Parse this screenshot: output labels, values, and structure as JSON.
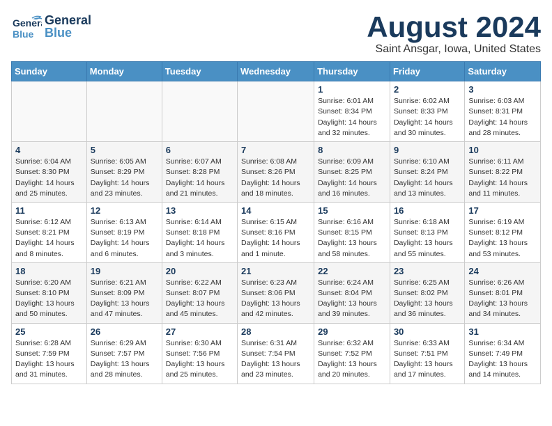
{
  "header": {
    "logo_general": "General",
    "logo_blue": "Blue",
    "main_title": "August 2024",
    "subtitle": "Saint Ansgar, Iowa, United States"
  },
  "days_of_week": [
    "Sunday",
    "Monday",
    "Tuesday",
    "Wednesday",
    "Thursday",
    "Friday",
    "Saturday"
  ],
  "weeks": [
    [
      {
        "day": "",
        "info": ""
      },
      {
        "day": "",
        "info": ""
      },
      {
        "day": "",
        "info": ""
      },
      {
        "day": "",
        "info": ""
      },
      {
        "day": "1",
        "info": "Sunrise: 6:01 AM\nSunset: 8:34 PM\nDaylight: 14 hours and 32 minutes."
      },
      {
        "day": "2",
        "info": "Sunrise: 6:02 AM\nSunset: 8:33 PM\nDaylight: 14 hours and 30 minutes."
      },
      {
        "day": "3",
        "info": "Sunrise: 6:03 AM\nSunset: 8:31 PM\nDaylight: 14 hours and 28 minutes."
      }
    ],
    [
      {
        "day": "4",
        "info": "Sunrise: 6:04 AM\nSunset: 8:30 PM\nDaylight: 14 hours and 25 minutes."
      },
      {
        "day": "5",
        "info": "Sunrise: 6:05 AM\nSunset: 8:29 PM\nDaylight: 14 hours and 23 minutes."
      },
      {
        "day": "6",
        "info": "Sunrise: 6:07 AM\nSunset: 8:28 PM\nDaylight: 14 hours and 21 minutes."
      },
      {
        "day": "7",
        "info": "Sunrise: 6:08 AM\nSunset: 8:26 PM\nDaylight: 14 hours and 18 minutes."
      },
      {
        "day": "8",
        "info": "Sunrise: 6:09 AM\nSunset: 8:25 PM\nDaylight: 14 hours and 16 minutes."
      },
      {
        "day": "9",
        "info": "Sunrise: 6:10 AM\nSunset: 8:24 PM\nDaylight: 14 hours and 13 minutes."
      },
      {
        "day": "10",
        "info": "Sunrise: 6:11 AM\nSunset: 8:22 PM\nDaylight: 14 hours and 11 minutes."
      }
    ],
    [
      {
        "day": "11",
        "info": "Sunrise: 6:12 AM\nSunset: 8:21 PM\nDaylight: 14 hours and 8 minutes."
      },
      {
        "day": "12",
        "info": "Sunrise: 6:13 AM\nSunset: 8:19 PM\nDaylight: 14 hours and 6 minutes."
      },
      {
        "day": "13",
        "info": "Sunrise: 6:14 AM\nSunset: 8:18 PM\nDaylight: 14 hours and 3 minutes."
      },
      {
        "day": "14",
        "info": "Sunrise: 6:15 AM\nSunset: 8:16 PM\nDaylight: 14 hours and 1 minute."
      },
      {
        "day": "15",
        "info": "Sunrise: 6:16 AM\nSunset: 8:15 PM\nDaylight: 13 hours and 58 minutes."
      },
      {
        "day": "16",
        "info": "Sunrise: 6:18 AM\nSunset: 8:13 PM\nDaylight: 13 hours and 55 minutes."
      },
      {
        "day": "17",
        "info": "Sunrise: 6:19 AM\nSunset: 8:12 PM\nDaylight: 13 hours and 53 minutes."
      }
    ],
    [
      {
        "day": "18",
        "info": "Sunrise: 6:20 AM\nSunset: 8:10 PM\nDaylight: 13 hours and 50 minutes."
      },
      {
        "day": "19",
        "info": "Sunrise: 6:21 AM\nSunset: 8:09 PM\nDaylight: 13 hours and 47 minutes."
      },
      {
        "day": "20",
        "info": "Sunrise: 6:22 AM\nSunset: 8:07 PM\nDaylight: 13 hours and 45 minutes."
      },
      {
        "day": "21",
        "info": "Sunrise: 6:23 AM\nSunset: 8:06 PM\nDaylight: 13 hours and 42 minutes."
      },
      {
        "day": "22",
        "info": "Sunrise: 6:24 AM\nSunset: 8:04 PM\nDaylight: 13 hours and 39 minutes."
      },
      {
        "day": "23",
        "info": "Sunrise: 6:25 AM\nSunset: 8:02 PM\nDaylight: 13 hours and 36 minutes."
      },
      {
        "day": "24",
        "info": "Sunrise: 6:26 AM\nSunset: 8:01 PM\nDaylight: 13 hours and 34 minutes."
      }
    ],
    [
      {
        "day": "25",
        "info": "Sunrise: 6:28 AM\nSunset: 7:59 PM\nDaylight: 13 hours and 31 minutes."
      },
      {
        "day": "26",
        "info": "Sunrise: 6:29 AM\nSunset: 7:57 PM\nDaylight: 13 hours and 28 minutes."
      },
      {
        "day": "27",
        "info": "Sunrise: 6:30 AM\nSunset: 7:56 PM\nDaylight: 13 hours and 25 minutes."
      },
      {
        "day": "28",
        "info": "Sunrise: 6:31 AM\nSunset: 7:54 PM\nDaylight: 13 hours and 23 minutes."
      },
      {
        "day": "29",
        "info": "Sunrise: 6:32 AM\nSunset: 7:52 PM\nDaylight: 13 hours and 20 minutes."
      },
      {
        "day": "30",
        "info": "Sunrise: 6:33 AM\nSunset: 7:51 PM\nDaylight: 13 hours and 17 minutes."
      },
      {
        "day": "31",
        "info": "Sunrise: 6:34 AM\nSunset: 7:49 PM\nDaylight: 13 hours and 14 minutes."
      }
    ]
  ]
}
